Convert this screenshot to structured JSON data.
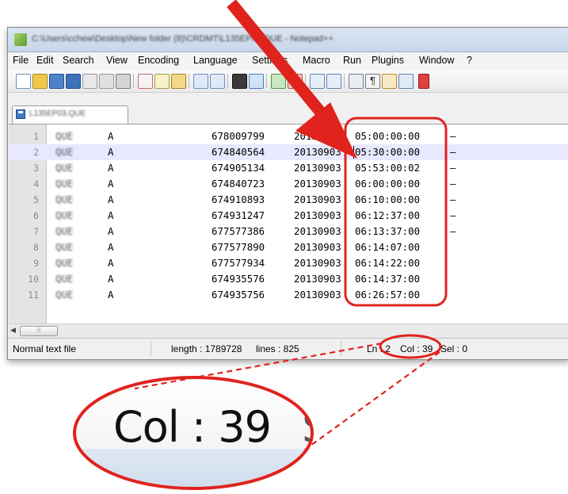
{
  "window": {
    "title": "C:\\Users\\cchew\\Desktop\\New folder (8)\\CRDMT\\L135EP03.QUE - Notepad++"
  },
  "menu": [
    "File",
    "Edit",
    "Search",
    "View",
    "Encoding",
    "Language",
    "Settings",
    "Macro",
    "Run",
    "Plugins",
    "Window",
    "?"
  ],
  "tab": {
    "label": "L135EP03.QUE"
  },
  "editor": {
    "rows": [
      {
        "ln": "1",
        "c1": "QUE",
        "c2": "A",
        "c3": "678009799",
        "c4": "20130903",
        "c5": "05:00:00:00",
        "c6": "–"
      },
      {
        "ln": "2",
        "c1": "QUE",
        "c2": "A",
        "c3": "674840564",
        "c4": "20130903",
        "c5": "05:30:00:00",
        "c6": "–"
      },
      {
        "ln": "3",
        "c1": "QUE",
        "c2": "A",
        "c3": "674905134",
        "c4": "20130903",
        "c5": "05:53:00:02",
        "c6": "–"
      },
      {
        "ln": "4",
        "c1": "QUE",
        "c2": "A",
        "c3": "674840723",
        "c4": "20130903",
        "c5": "06:00:00:00",
        "c6": "–"
      },
      {
        "ln": "5",
        "c1": "QUE",
        "c2": "A",
        "c3": "674910893",
        "c4": "20130903",
        "c5": "06:10:00:00",
        "c6": "–"
      },
      {
        "ln": "6",
        "c1": "QUE",
        "c2": "A",
        "c3": "674931247",
        "c4": "20130903",
        "c5": "06:12:37:00",
        "c6": "–"
      },
      {
        "ln": "7",
        "c1": "QUE",
        "c2": "A",
        "c3": "677577386",
        "c4": "20130903",
        "c5": "06:13:37:00",
        "c6": "–"
      },
      {
        "ln": "8",
        "c1": "QUE",
        "c2": "A",
        "c3": "677577890",
        "c4": "20130903",
        "c5": "06:14:07:00",
        "c6": ""
      },
      {
        "ln": "9",
        "c1": "QUE",
        "c2": "A",
        "c3": "677577934",
        "c4": "20130903",
        "c5": "06:14:22:00",
        "c6": ""
      },
      {
        "ln": "10",
        "c1": "QUE",
        "c2": "A",
        "c3": "674935576",
        "c4": "20130903",
        "c5": "06:14:37:00",
        "c6": ""
      },
      {
        "ln": "11",
        "c1": "QUE",
        "c2": "A",
        "c3": "674935756",
        "c4": "20130903",
        "c5": "06:26:57:00",
        "c6": ""
      }
    ],
    "current_line": 2
  },
  "status": {
    "file_type": "Normal text file",
    "length": "length : 1789728",
    "lines": "lines : 825",
    "ln": "Ln : 2",
    "col": "Col : 39",
    "sel": "Sel : 0"
  },
  "zoom": {
    "text": "Col : 39",
    "cut": "S"
  },
  "colors": {
    "annotation_red": "#e0231d",
    "current_line_bg": "#e8e8ff",
    "gutter_bg": "#e4e4e4"
  },
  "icons": [
    "new-file-icon",
    "open-file-icon",
    "save-icon",
    "save-all-icon",
    "close-icon",
    "close-all-icon",
    "print-icon",
    "cut-icon",
    "copy-icon",
    "paste-icon",
    "undo-icon",
    "redo-icon",
    "find-icon",
    "replace-icon",
    "zoom-in-icon",
    "zoom-out-icon",
    "sync-v-icon",
    "sync-h-icon",
    "wrap-icon",
    "all-chars-icon",
    "indent-guide-icon",
    "doc-map-icon"
  ]
}
